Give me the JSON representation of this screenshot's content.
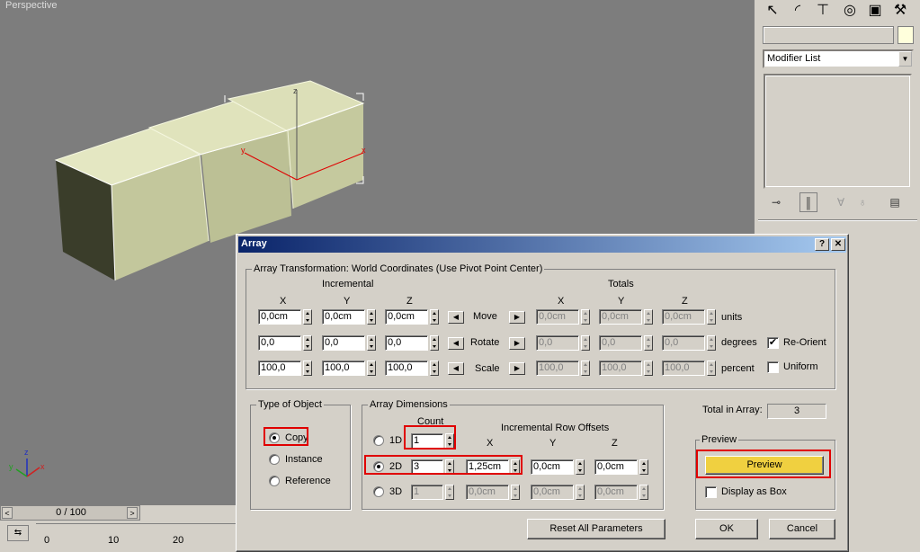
{
  "viewport": {
    "label": "Perspective",
    "axis_x": "x",
    "axis_y": "y",
    "axis_z": "z",
    "gizmo_x": "x",
    "gizmo_y": "y",
    "gizmo_z": "z"
  },
  "timeline": {
    "position": "0 / 100",
    "prev": "<",
    "next": ">",
    "ticks": [
      "0",
      "10",
      "20"
    ]
  },
  "command_panel": {
    "tab_icons": [
      "create-icon",
      "modify-icon",
      "hierarchy-icon",
      "motion-icon",
      "display-icon",
      "utilities-icon"
    ],
    "name_value": "",
    "swatch_color": "#ffffdc",
    "modifier_list": "Modifier List"
  },
  "dialog": {
    "title": "Array",
    "help": "?",
    "close": "✕",
    "transform_group": "Array Transformation: World Coordinates (Use Pivot Point Center)",
    "incremental": "Incremental",
    "totals": "Totals",
    "axes": [
      "X",
      "Y",
      "Z"
    ],
    "rows": [
      {
        "label": "Move",
        "inc": [
          "0,0cm",
          "0,0cm",
          "0,0cm"
        ],
        "tot": [
          "0,0cm",
          "0,0cm",
          "0,0cm"
        ],
        "unit": "units"
      },
      {
        "label": "Rotate",
        "inc": [
          "0,0",
          "0,0",
          "0,0"
        ],
        "tot": [
          "0,0",
          "0,0",
          "0,0"
        ],
        "unit": "degrees"
      },
      {
        "label": "Scale",
        "inc": [
          "100,0",
          "100,0",
          "100,0"
        ],
        "tot": [
          "100,0",
          "100,0",
          "100,0"
        ],
        "unit": "percent"
      }
    ],
    "reorient": {
      "label": "Re-Orient",
      "checked": "✔"
    },
    "uniform": {
      "label": "Uniform",
      "checked": ""
    },
    "type_group": "Type of Object",
    "types": [
      "Copy",
      "Instance",
      "Reference"
    ],
    "selected_type": "Copy",
    "dim_group": "Array Dimensions",
    "count_label": "Count",
    "row_offsets_label": "Incremental Row Offsets",
    "dims": [
      {
        "label": "1D",
        "count": "1",
        "x": "",
        "y": "",
        "z": ""
      },
      {
        "label": "2D",
        "count": "3",
        "x": "1,25cm",
        "y": "0,0cm",
        "z": "0,0cm"
      },
      {
        "label": "3D",
        "count": "1",
        "x": "0,0cm",
        "y": "0,0cm",
        "z": "0,0cm"
      }
    ],
    "selected_dim": "2D",
    "total_label": "Total in Array:",
    "total_value": "3",
    "preview_group": "Preview",
    "preview_button": "Preview",
    "preview_active_color": "#f0d040",
    "display_as_box": "Display as Box",
    "reset_button": "Reset All Parameters",
    "ok_button": "OK",
    "cancel_button": "Cancel"
  }
}
